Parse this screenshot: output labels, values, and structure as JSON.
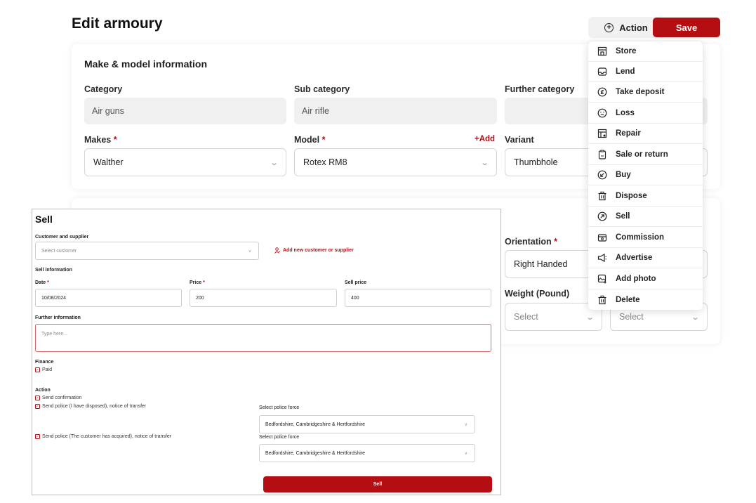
{
  "header": {
    "title": "Edit armoury",
    "action_label": "Action",
    "save_label": "Save"
  },
  "make_model": {
    "section_title": "Make & model information",
    "category_label": "Category",
    "category_value": "Air guns",
    "subcategory_label": "Sub category",
    "subcategory_value": "Air rifle",
    "further_category_label": "Further category",
    "further_category_value": "",
    "makes_label": "Makes",
    "makes_value": "Walther",
    "model_label": "Model",
    "model_value": "Rotex RM8",
    "model_add": "+Add",
    "variant_label": "Variant",
    "variant_value": "Thumbhole",
    "required_mark": "*"
  },
  "details": {
    "orientation_label": "Orientation",
    "orientation_value": "Right Handed",
    "weight_label": "Weight (Pound)",
    "weight_value": "Select",
    "other_value": "Select"
  },
  "action_menu": {
    "items": [
      {
        "label": "Store",
        "icon": "store-icon"
      },
      {
        "label": "Lend",
        "icon": "inbox-icon"
      },
      {
        "label": "Take deposit",
        "icon": "pound-icon"
      },
      {
        "label": "Loss",
        "icon": "sad-face-icon"
      },
      {
        "label": "Repair",
        "icon": "repair-icon"
      },
      {
        "label": "Sale or return",
        "icon": "clipboard-icon"
      },
      {
        "label": "Buy",
        "icon": "arrow-down-left-icon"
      },
      {
        "label": "Dispose",
        "icon": "trash-icon"
      },
      {
        "label": "Sell",
        "icon": "arrow-up-right-icon"
      },
      {
        "label": "Commission",
        "icon": "commission-icon"
      },
      {
        "label": "Advertise",
        "icon": "megaphone-icon"
      },
      {
        "label": "Add photo",
        "icon": "add-photo-icon"
      },
      {
        "label": "Delete",
        "icon": "trash-icon"
      }
    ]
  },
  "sell": {
    "title": "Sell",
    "customer_label": "Customer and supplier",
    "customer_placeholder": "Select customer",
    "add_customer": "Add new customer or supplier",
    "sell_info_label": "Sell information",
    "date_label": "Date",
    "date_value": "10/08/2024",
    "price_label": "Price",
    "price_value": "200",
    "sell_price_label": "Sell price",
    "sell_price_value": "400",
    "further_info_label": "Further information",
    "further_info_placeholder": "Type here...",
    "finance_label": "Finance",
    "paid_label": "Paid",
    "action_label": "Action",
    "send_confirmation": "Send confirmation",
    "send_police_disposed": "Send police (I have disposed), notice of transfer",
    "send_police_acquired": "Send police (The customer has acquired), notice of transfer",
    "police_force_label": "Select police force",
    "police_force_value_1": "Bedfordshire, Cambridgeshire & Hertfordshire",
    "police_force_value_2": "Bedfordshire, Cambridgeshire & Hertfordshire",
    "sell_button": "Sell"
  },
  "colors": {
    "accent": "#b40e12",
    "field_bg": "#f0f0f1"
  }
}
